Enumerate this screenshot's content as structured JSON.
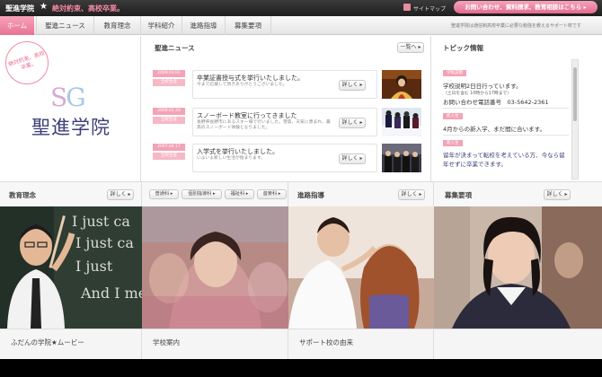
{
  "topbar": {
    "brand": "聖進学院",
    "star": "★",
    "slogan": "絶対約束、高校卒業。",
    "sitemap_label": "サイトマップ",
    "inquiry_label": "お問い合わせ、資料請求、教育相談はこちら ▸"
  },
  "nav": {
    "tabs": [
      "ホーム",
      "聖進ニュース",
      "教育理念",
      "学科紹介",
      "進路指導",
      "募集要項"
    ],
    "tagline": "聖進学院は通信制高校卒業に必要な勉強を教えるサポート校です"
  },
  "logo": {
    "circle_text": "絶対約束、高校卒業。",
    "sg_s": "S",
    "sg_g": "G",
    "name": "聖進学院"
  },
  "news": {
    "title": "聖進ニュース",
    "more_label": "一覧へ ▸",
    "items": [
      {
        "date": "2009.03.01",
        "category": "全校生徒",
        "title": "卒業証書授与式を挙行いたしました。",
        "desc": "今まで応援して頂きありがとうございました。",
        "button": "詳しく ▸"
      },
      {
        "date": "2009.01.20",
        "category": "全校生徒",
        "title": "スノーボード教室に行ってきました",
        "desc": "長野県長野市にあるスキー場で行いました。雪質、天気に恵まれ、最高のスノーボード体験となりました。",
        "button": "詳しく ▸"
      },
      {
        "date": "2007.04.17",
        "category": "全校生徒",
        "title": "入学式を挙行いたしました。",
        "desc": "いよいよ新しい生活が始まります。",
        "button": "詳しく ▸"
      }
    ]
  },
  "topics": {
    "title": "トピック情報",
    "tag1": "学校説明",
    "line1": "学校説明2日日行っています。",
    "line1_small": "（土日を含む 10時から17時まで）",
    "line1b": "お問い合わせ電話番号　03-5642-2361",
    "tag2": "新入生",
    "line2": "4月からの新入学、まだ間に合います。",
    "tag3": "新入生",
    "line3a": "留年が決まって転校を考えている方、今なら留",
    "line3b": "年せずに卒業できます。"
  },
  "features": [
    {
      "title": "教育理念",
      "button": "詳しく ▸"
    },
    {
      "title": "",
      "pills": [
        "普通科 ▸",
        "個別指導科 ▸",
        "福祉科 ▸",
        "音楽科 ▸"
      ]
    },
    {
      "title": "進路指導",
      "button": "詳しく ▸"
    },
    {
      "title": "募集要項",
      "button": "詳しく ▸"
    }
  ],
  "footer_labels": [
    "ふだんの学院★ムービー",
    "学校案内",
    "サポート校の由来",
    ""
  ],
  "colors": {
    "accent_pink": "#e87393",
    "navy": "#3b3f78",
    "topbar": "#2a2a2a"
  }
}
